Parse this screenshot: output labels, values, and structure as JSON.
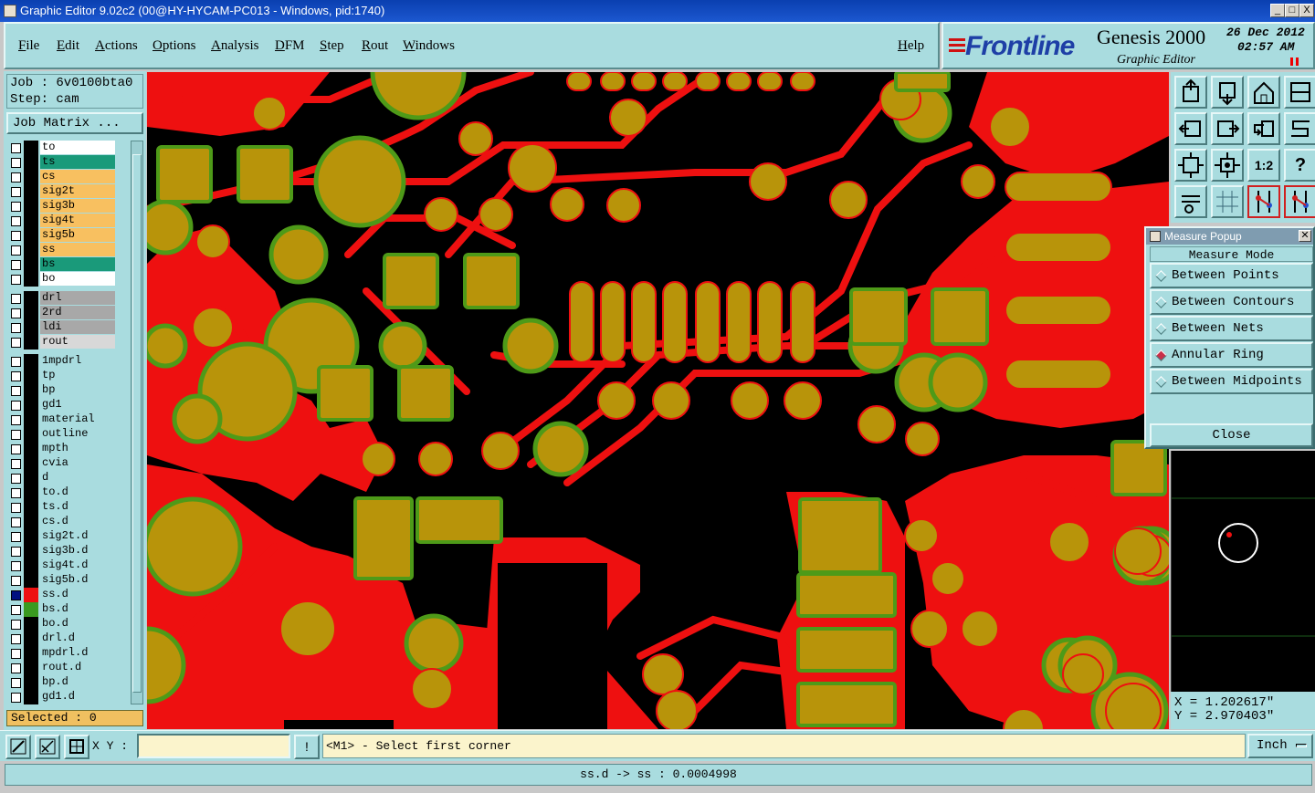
{
  "window": {
    "title": "Graphic Editor 9.02c2 (00@HY-HYCAM-PC013 - Windows, pid:1740)",
    "controls": [
      "_",
      "□",
      "X"
    ]
  },
  "menu": {
    "items": [
      "File",
      "Edit",
      "Actions",
      "Options",
      "Analysis",
      "DFM",
      "Step",
      "Rout",
      "Windows"
    ],
    "help": "Help"
  },
  "brand": {
    "logo": "Frontline",
    "product": "Genesis 2000",
    "subtitle": "Graphic Editor",
    "date": "26 Dec 2012",
    "time": "02:57 AM"
  },
  "job": {
    "job_line": "Job : 6v0100bta0",
    "step_line": "Step: cam",
    "matrix_button": "Job Matrix ..."
  },
  "layers": [
    {
      "name": "to",
      "color": "#ffffff",
      "swatch": "#000000",
      "checked": false
    },
    {
      "name": "ts",
      "color": "#1a9a7a",
      "swatch": "#000000",
      "checked": false
    },
    {
      "name": "cs",
      "color": "#f8c060",
      "swatch": "#000000",
      "checked": false
    },
    {
      "name": "sig2t",
      "color": "#f8c060",
      "swatch": "#000000",
      "checked": false
    },
    {
      "name": "sig3b",
      "color": "#f8c060",
      "swatch": "#000000",
      "checked": false
    },
    {
      "name": "sig4t",
      "color": "#f8c060",
      "swatch": "#000000",
      "checked": false
    },
    {
      "name": "sig5b",
      "color": "#f8c060",
      "swatch": "#000000",
      "checked": false
    },
    {
      "name": "ss",
      "color": "#f8c060",
      "swatch": "#000000",
      "checked": false
    },
    {
      "name": "bs",
      "color": "#1a9a7a",
      "swatch": "#000000",
      "checked": false
    },
    {
      "name": "bo",
      "color": "#ffffff",
      "swatch": "#000000",
      "checked": false
    },
    {
      "name": "drl",
      "color": "#a8a8a8",
      "swatch": "#000000",
      "checked": false
    },
    {
      "name": "2rd",
      "color": "#a8a8a8",
      "swatch": "#000000",
      "checked": false
    },
    {
      "name": "ldi",
      "color": "#a8a8a8",
      "swatch": "#000000",
      "checked": false
    },
    {
      "name": "rout",
      "color": "#d8d8d8",
      "swatch": "#000000",
      "checked": false
    },
    {
      "name": "1mpdrl",
      "color": "#a9dcdf",
      "swatch": "#000000",
      "checked": false
    },
    {
      "name": "tp",
      "color": "#a9dcdf",
      "swatch": "#000000",
      "checked": false
    },
    {
      "name": "bp",
      "color": "#a9dcdf",
      "swatch": "#000000",
      "checked": false
    },
    {
      "name": "gd1",
      "color": "#a9dcdf",
      "swatch": "#000000",
      "checked": false
    },
    {
      "name": "material",
      "color": "#a9dcdf",
      "swatch": "#000000",
      "checked": false
    },
    {
      "name": "outline",
      "color": "#a9dcdf",
      "swatch": "#000000",
      "checked": false
    },
    {
      "name": "mpth",
      "color": "#a9dcdf",
      "swatch": "#000000",
      "checked": false
    },
    {
      "name": "cvia",
      "color": "#a9dcdf",
      "swatch": "#000000",
      "checked": false
    },
    {
      "name": "d",
      "color": "#a9dcdf",
      "swatch": "#000000",
      "checked": false
    },
    {
      "name": "to.d",
      "color": "#a9dcdf",
      "swatch": "#000000",
      "checked": false
    },
    {
      "name": "ts.d",
      "color": "#a9dcdf",
      "swatch": "#000000",
      "checked": false
    },
    {
      "name": "cs.d",
      "color": "#a9dcdf",
      "swatch": "#000000",
      "checked": false
    },
    {
      "name": "sig2t.d",
      "color": "#a9dcdf",
      "swatch": "#000000",
      "checked": false
    },
    {
      "name": "sig3b.d",
      "color": "#a9dcdf",
      "swatch": "#000000",
      "checked": false
    },
    {
      "name": "sig4t.d",
      "color": "#a9dcdf",
      "swatch": "#000000",
      "checked": false
    },
    {
      "name": "sig5b.d",
      "color": "#a9dcdf",
      "swatch": "#000000",
      "checked": false
    },
    {
      "name": "ss.d",
      "color": "#a9dcdf",
      "swatch": "#ee1010",
      "checked": true
    },
    {
      "name": "bs.d",
      "color": "#a9dcdf",
      "swatch": "#3a9a20",
      "checked": false
    },
    {
      "name": "bo.d",
      "color": "#a9dcdf",
      "swatch": "#000000",
      "checked": false
    },
    {
      "name": "drl.d",
      "color": "#a9dcdf",
      "swatch": "#000000",
      "checked": false
    },
    {
      "name": "mpdrl.d",
      "color": "#a9dcdf",
      "swatch": "#000000",
      "checked": false
    },
    {
      "name": "rout.d",
      "color": "#a9dcdf",
      "swatch": "#000000",
      "checked": false
    },
    {
      "name": "bp.d",
      "color": "#a9dcdf",
      "swatch": "#000000",
      "checked": false
    },
    {
      "name": "gd1.d",
      "color": "#a9dcdf",
      "swatch": "#000000",
      "checked": false
    }
  ],
  "selected": "Selected : 0",
  "tools": [
    "zoom-home-icon",
    "zoom-back-icon",
    "home-icon",
    "split-view-icon",
    "pan-left-icon",
    "pan-right-icon",
    "undo-icon",
    "snake-icon",
    "fit-icon",
    "center-icon",
    "scale-icon",
    "help-icon",
    "tools-icon",
    "grid-icon",
    "layer-red-icon",
    "layer-red2-icon"
  ],
  "tool_labels": {
    "scale": "1:2",
    "help": "?"
  },
  "measure_popup": {
    "title": "Measure Popup",
    "mode_label": "Measure Mode",
    "options": [
      "Between Points",
      "Between Contours",
      "Between Nets",
      "Annular Ring",
      "Between Midpoints"
    ],
    "selected_option": "Annular Ring",
    "close": "Close"
  },
  "coordinates": {
    "x": "X = 1.202617\"",
    "y": "Y = 2.970403\""
  },
  "bottom": {
    "xy_label": "X Y :",
    "xy_value": "",
    "warn": "!",
    "prompt": "<M1> - Select first corner",
    "units": "Inch"
  },
  "status": "ss.d -> ss : 0.0004998",
  "colors": {
    "copper": "#ee1010",
    "pad": "#b8940a",
    "mask": "#4e9a18",
    "background": "#000000",
    "panel": "#a9dcdf"
  }
}
